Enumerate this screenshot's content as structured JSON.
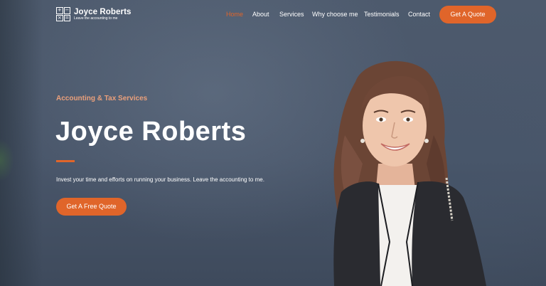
{
  "brand": {
    "name": "Joyce Roberts",
    "tagline": "Leave the accounting to me",
    "logo_symbols": [
      "+",
      "−",
      "×",
      "="
    ],
    "icon": "calculator-icon"
  },
  "nav": {
    "items": [
      {
        "label": "Home",
        "active": true
      },
      {
        "label": "About"
      },
      {
        "label": "Services"
      },
      {
        "label": "Why choose me"
      },
      {
        "label": "Testimonials"
      },
      {
        "label": "Contact"
      }
    ],
    "cta_label": "Get A Quote"
  },
  "hero": {
    "eyebrow": "Accounting & Tax Services",
    "title": "Joyce Roberts",
    "subtitle": "Invest your time and efforts on running your business. Leave the accounting to me.",
    "cta_label": "Get A Free Quote"
  },
  "colors": {
    "accent": "#e0652a",
    "eyebrow": "#eba07b",
    "background": "#4a5669",
    "text": "#ffffff"
  }
}
